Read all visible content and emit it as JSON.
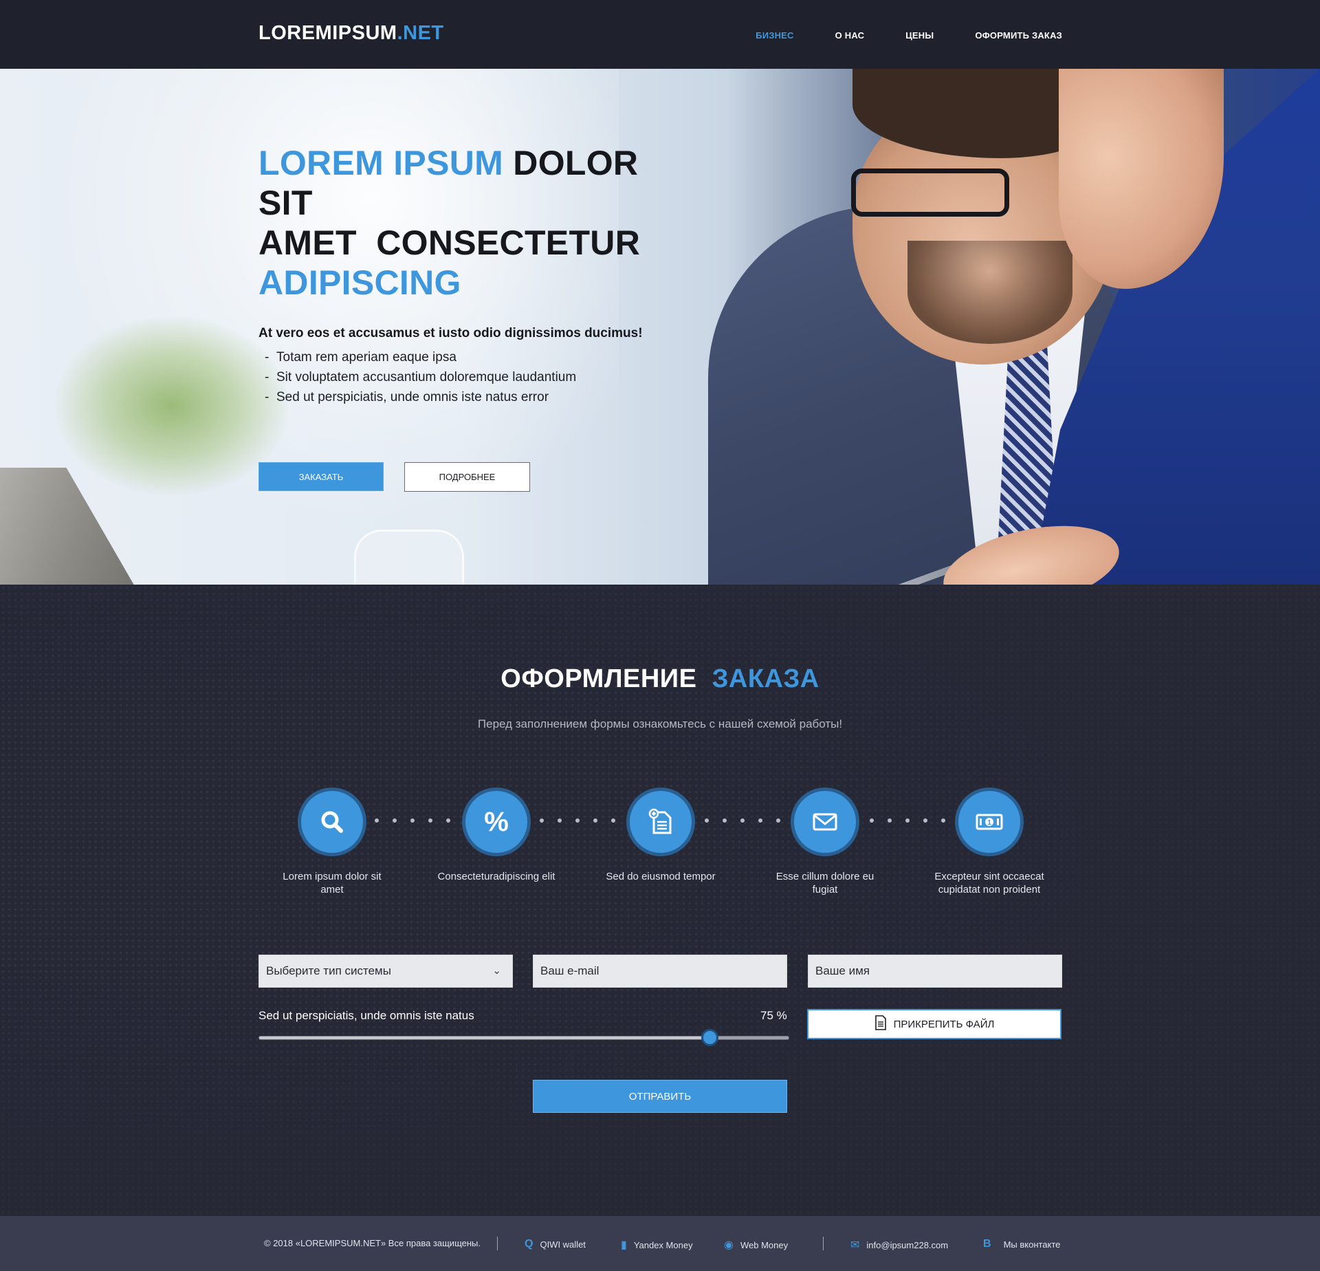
{
  "header": {
    "logo_main": "LOREMIPSUM",
    "logo_accent": ".NET",
    "nav": [
      {
        "label": "БИЗНЕС",
        "active": true
      },
      {
        "label": "О НАС",
        "active": false
      },
      {
        "label": "ЦЕНЫ",
        "active": false
      },
      {
        "label": "ОФОРМИТЬ ЗАКАЗ",
        "active": false
      }
    ]
  },
  "hero": {
    "title_part1_blue": "LOREM IPSUM",
    "title_part2": "DOLOR SIT",
    "title_part3": "AMET  CONSECTETUR",
    "title_part4_blue": "ADIPISCING",
    "lead": "At vero eos et accusamus et iusto odio dignissimos ducimus!",
    "list": [
      "Totam rem aperiam eaque ipsa",
      "Sit voluptatem accusantium doloremque laudantium",
      "Sed ut perspiciatis, unde omnis iste natus error"
    ],
    "btn_primary": "ЗАКАЗАТЬ",
    "btn_secondary": "ПОДРОБНЕЕ"
  },
  "order": {
    "title_white": "ОФОРМЛЕНИЕ",
    "title_blue": "ЗАКАЗА",
    "subtitle": "Перед заполнением формы ознакомьтесь с нашей схемой работы!",
    "steps": [
      {
        "icon": "search-icon",
        "label": "Lorem ipsum dolor  sit amet"
      },
      {
        "icon": "percent-icon",
        "label": "Consecteturadipiscing elit"
      },
      {
        "icon": "document-add-icon",
        "label": "Sed do eiusmod tempor"
      },
      {
        "icon": "envelope-icon",
        "label": "Esse cillum dolore  eu fugiat"
      },
      {
        "icon": "banknote-icon",
        "label": "Excepteur sint occaecat cupidatat non proident"
      }
    ],
    "system_select": "Выберите тип системы",
    "email_placeholder": "Ваш e-mail",
    "name_placeholder": "Ваше имя",
    "range_label": "Sed ut perspiciatis, unde omnis iste natus",
    "range_value_text": "75 %",
    "range_value": 0.85,
    "attach_label": "ПРИКРЕПИТЬ ФАЙЛ",
    "submit_label": "ОТПРАВИТЬ"
  },
  "footer": {
    "copyright": "© 2018 «LOREMIPSUM.NET» Все права защищены.",
    "qiwi": "QIWI wallet",
    "yandex": "Yandex Money",
    "webmoney": "Web Money",
    "email": "info@ipsum228.com",
    "vk_icon_letter": "B",
    "vk": "Мы вконтакте"
  },
  "colors": {
    "accent": "#3e97dc",
    "dark_bg": "#262836",
    "header_bg": "#1f212d",
    "footer_bg": "#3a3c4f"
  }
}
